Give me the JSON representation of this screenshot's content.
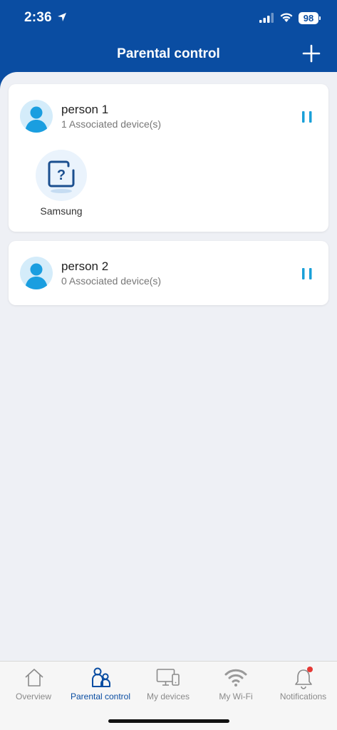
{
  "status": {
    "time": "2:36",
    "battery": "98"
  },
  "header": {
    "title": "Parental control"
  },
  "persons": [
    {
      "name": "person 1",
      "subtitle": "1 Associated device(s)",
      "devices": [
        "Samsung"
      ]
    },
    {
      "name": "person 2",
      "subtitle": "0 Associated device(s)",
      "devices": []
    }
  ],
  "tabs": [
    {
      "label": "Overview",
      "icon": "home-icon"
    },
    {
      "label": "Parental control",
      "icon": "parental-icon",
      "active": true
    },
    {
      "label": "My devices",
      "icon": "devices-icon"
    },
    {
      "label": "My Wi-Fi",
      "icon": "wifi-icon"
    },
    {
      "label": "Notifications",
      "icon": "bell-icon"
    }
  ],
  "colors": {
    "brand": "#0a4da2",
    "accent": "#1aa0d8",
    "notification_dot": "#e53935"
  }
}
